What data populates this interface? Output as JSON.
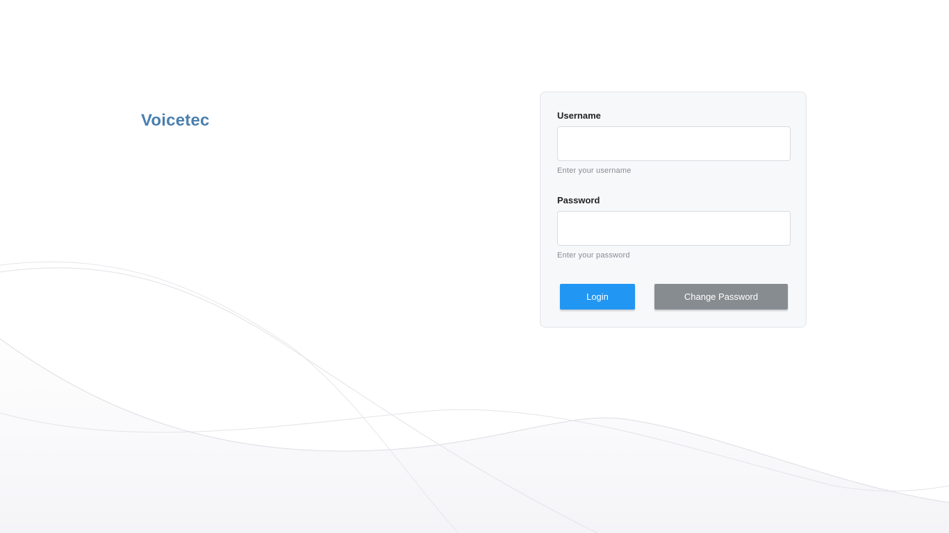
{
  "brand": {
    "name": "Voicetec"
  },
  "login_form": {
    "username": {
      "label": "Username",
      "value": "",
      "help": "Enter your username"
    },
    "password": {
      "label": "Password",
      "value": "",
      "help": "Enter your password"
    },
    "login_label": "Login",
    "change_password_label": "Change Password"
  },
  "colors": {
    "brand": "#4a7fae",
    "primary_button": "#2196f3",
    "secondary_button": "#878c91",
    "card_background": "#f7f8fa"
  }
}
